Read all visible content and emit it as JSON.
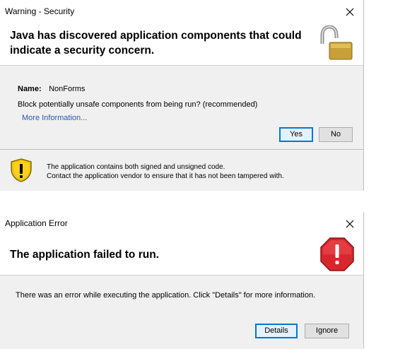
{
  "security_dialog": {
    "title": "Warning - Security",
    "headline_line1": "Java has discovered application components that could",
    "headline_line2": "indicate a security concern.",
    "name_label": "Name:",
    "name_value": "NonForms",
    "question": "Block potentially unsafe components from being run? (recommended)",
    "more_info_link": "More Information...",
    "yes_label": "Yes",
    "no_label": "No",
    "footer_line1": "The application contains both signed and unsigned code.",
    "footer_line2": "Contact the application vendor to ensure that it has not been tampered with.",
    "icons": [
      "close-icon",
      "open-padlock-icon",
      "warning-shield-icon"
    ],
    "colors": {
      "padlock_gold": "#c8a038",
      "shield_yellow": "#f2c200"
    }
  },
  "error_dialog": {
    "title": "Application Error",
    "headline": "The application failed to run.",
    "message": "There was an error while executing the application.  Click \"Details\" for more information.",
    "details_label": "Details",
    "ignore_label": "Ignore",
    "icons": [
      "close-icon",
      "error-stop-icon"
    ],
    "colors": {
      "stop_red": "#d9262c"
    }
  }
}
